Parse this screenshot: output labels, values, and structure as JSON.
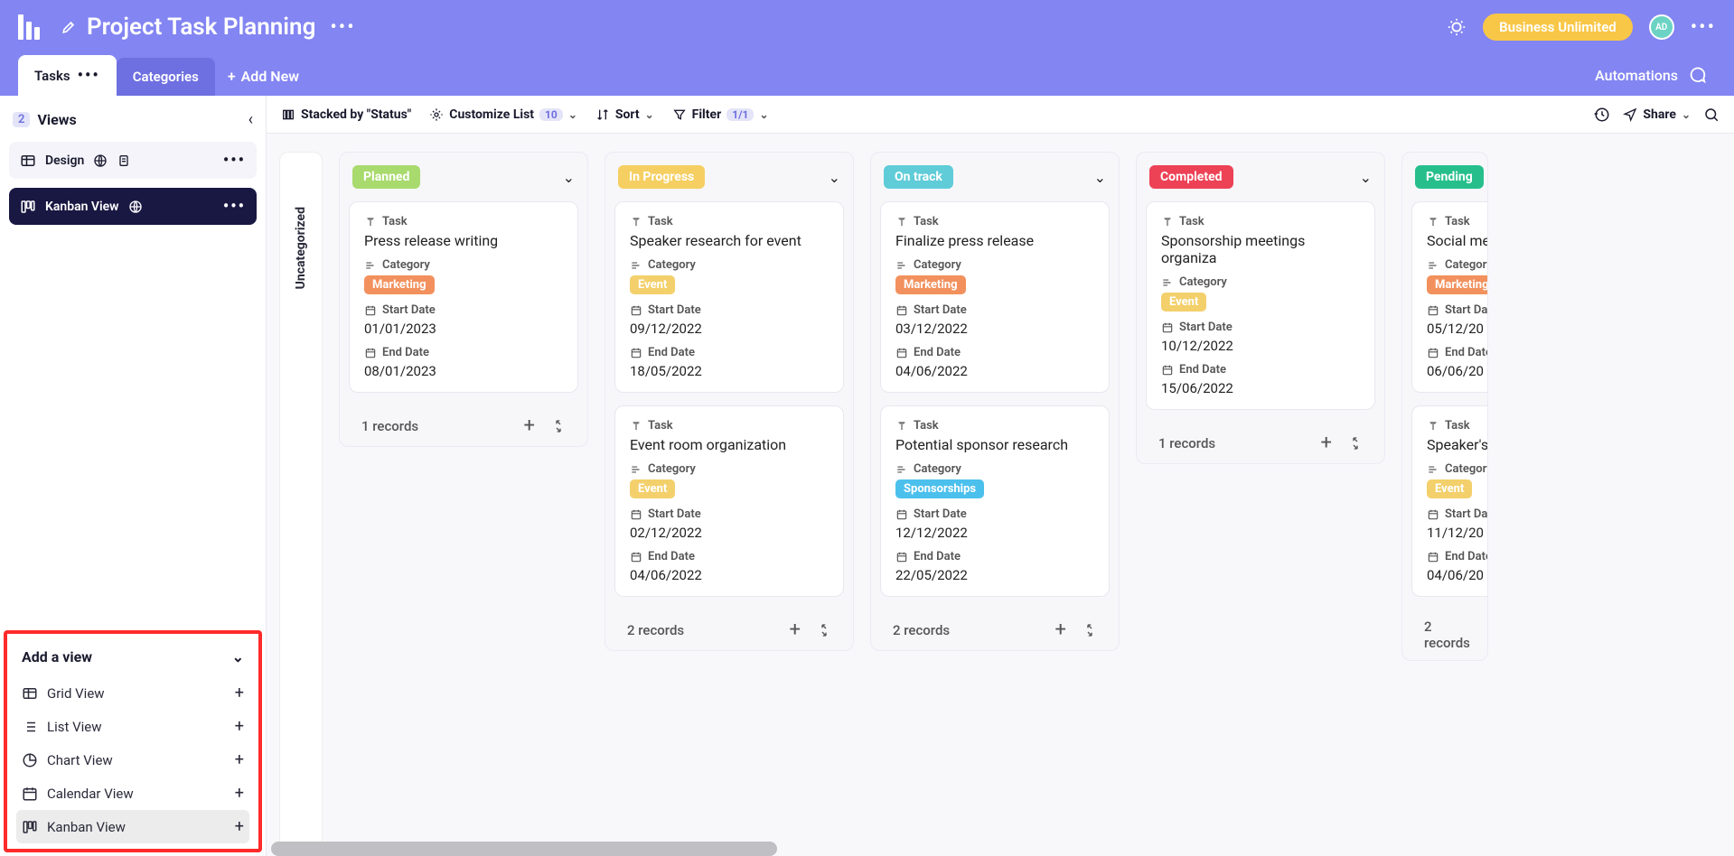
{
  "header": {
    "title": "Project Task Planning",
    "plan_badge": "Business Unlimited",
    "avatar_initials": "AD",
    "automations": "Automations"
  },
  "tabs": {
    "active": "Tasks",
    "inactive": "Categories",
    "add_new": "Add New"
  },
  "sidebar": {
    "views_count": "2",
    "views_label": "Views",
    "items": [
      {
        "label": "Design"
      },
      {
        "label": "Kanban View"
      }
    ],
    "add_view": {
      "title": "Add a view",
      "options": [
        {
          "label": "Grid View"
        },
        {
          "label": "List View"
        },
        {
          "label": "Chart View"
        },
        {
          "label": "Calendar View"
        },
        {
          "label": "Kanban View"
        }
      ]
    }
  },
  "toolbar": {
    "stacked": "Stacked by \"Status\"",
    "customize": "Customize List",
    "customize_count": "10",
    "sort": "Sort",
    "filter": "Filter",
    "filter_count": "1/1",
    "share": "Share"
  },
  "board": {
    "uncategorized": "Uncategorized",
    "field_task": "Task",
    "field_category": "Category",
    "field_start": "Start Date",
    "field_end": "End Date",
    "records_1": "1 records",
    "records_2": "2 records",
    "columns": [
      {
        "status": "Planned",
        "status_class": "c-planned",
        "records": "1 records",
        "cards": [
          {
            "title": "Press release writing",
            "category": "Marketing",
            "cat_class": "t-marketing",
            "start": "01/01/2023",
            "end": "08/01/2023"
          }
        ]
      },
      {
        "status": "In Progress",
        "status_class": "c-progress",
        "records": "2 records",
        "cards": [
          {
            "title": "Speaker research for event",
            "category": "Event",
            "cat_class": "t-event",
            "start": "09/12/2022",
            "end": "18/05/2022"
          },
          {
            "title": "Event room organization",
            "category": "Event",
            "cat_class": "t-event",
            "start": "02/12/2022",
            "end": "04/06/2022"
          }
        ]
      },
      {
        "status": "On track",
        "status_class": "c-ontrack",
        "records": "2 records",
        "cards": [
          {
            "title": "Finalize press release",
            "category": "Marketing",
            "cat_class": "t-marketing",
            "start": "03/12/2022",
            "end": "04/06/2022"
          },
          {
            "title": "Potential sponsor research",
            "category": "Sponsorships",
            "cat_class": "t-sponsor",
            "start": "12/12/2022",
            "end": "22/05/2022"
          }
        ]
      },
      {
        "status": "Completed",
        "status_class": "c-completed",
        "records": "1 records",
        "cards": [
          {
            "title": "Sponsorship meetings organiza",
            "category": "Event",
            "cat_class": "t-event",
            "start": "10/12/2022",
            "end": "15/06/2022"
          }
        ]
      },
      {
        "status": "Pending",
        "status_class": "c-pending",
        "records": "2 records",
        "cards": [
          {
            "title": "Social me",
            "category": "Marketing",
            "cat_class": "t-marketing",
            "start": "05/12/20",
            "end": "06/06/20"
          },
          {
            "title": "Speaker's",
            "category": "Event",
            "cat_class": "t-event",
            "start": "11/12/20",
            "end": "04/06/20"
          }
        ]
      }
    ]
  }
}
